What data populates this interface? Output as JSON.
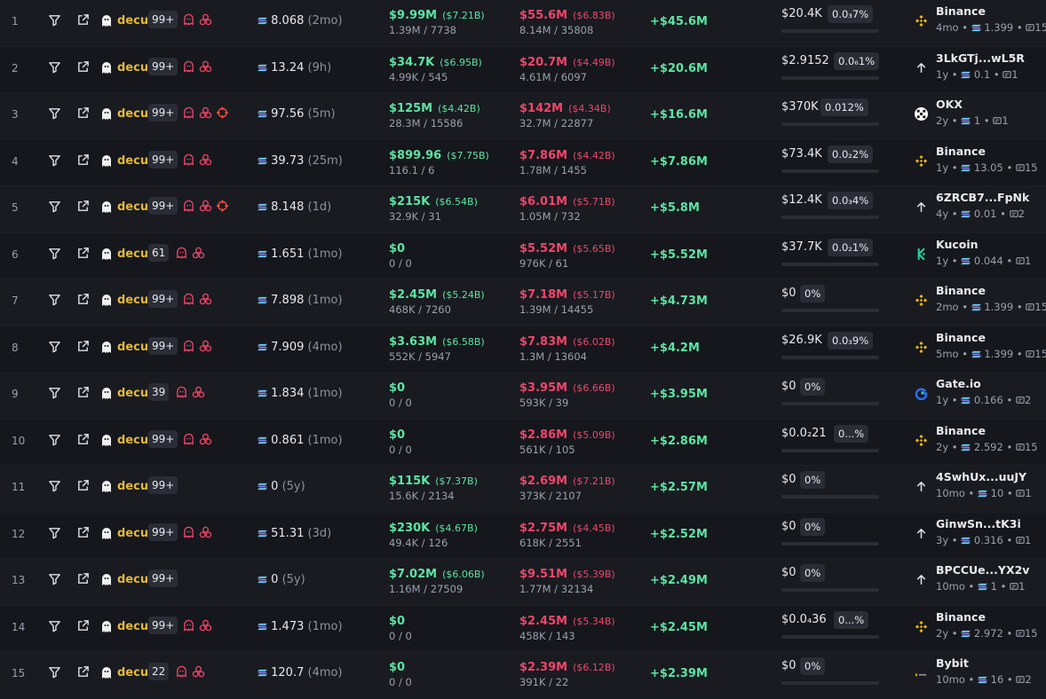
{
  "colors": {
    "background": "#15171c",
    "row_alt": "#191b21",
    "name_gold": "#e3b83b",
    "green": "#5ee3a2",
    "red": "#f0456a",
    "muted": "#9aa0ad",
    "badge_bg": "#2a2d35",
    "flag_pink": "#f0456a"
  },
  "icons": {
    "filter": "filter-icon",
    "open": "external-link-icon",
    "avatar": "ghost-icon",
    "balance": "solana-icon",
    "flags": [
      "ghost-flag-icon",
      "cluster-flag-icon",
      "crosshair-flag-icon"
    ],
    "exchange_binance": "binance-logo",
    "exchange_okx": "okx-logo",
    "exchange_kucoin": "kucoin-logo",
    "exchange_gate": "gate-logo",
    "exchange_bybit": "bybit-logo",
    "wallet_arrow": "arrow-up-icon",
    "tx": "tx-icon"
  },
  "rows": [
    {
      "rank": "1",
      "name": "decu",
      "count": "99+",
      "flags": [
        "ghost",
        "cluster"
      ],
      "balance": "8.068",
      "age": "(2mo)",
      "buy": "$9.99M",
      "buy_mc": "($7.21B)",
      "buy_sub": "1.39M / 7738",
      "sell": "$55.6M",
      "sell_mc": "($6.83B)",
      "sell_sub": "8.14M / 35808",
      "pnl": "+$45.6M",
      "hold": "$20.4K",
      "pct": "0.0₃7%",
      "source_icon": "binance",
      "source": "Binance",
      "src_age": "4mo",
      "src_bal": "1.399",
      "src_tx": "15"
    },
    {
      "rank": "2",
      "name": "decu",
      "count": "99+",
      "flags": [
        "ghost",
        "cluster"
      ],
      "balance": "13.24",
      "age": "(9h)",
      "buy": "$34.7K",
      "buy_mc": "($6.95B)",
      "buy_sub": "4.99K / 545",
      "sell": "$20.7M",
      "sell_mc": "($4.49B)",
      "sell_sub": "4.61M / 6097",
      "pnl": "+$20.6M",
      "hold": "$2.9152",
      "pct": "0.0₆1%",
      "source_icon": "arrow",
      "source": "3LkGTj...wL5R",
      "src_age": "1y",
      "src_bal": "0.1",
      "src_tx": "1"
    },
    {
      "rank": "3",
      "name": "decu",
      "count": "99+",
      "flags": [
        "ghost",
        "cluster",
        "crosshair"
      ],
      "balance": "97.56",
      "age": "(5m)",
      "buy": "$125M",
      "buy_mc": "($4.42B)",
      "buy_sub": "28.3M / 15586",
      "sell": "$142M",
      "sell_mc": "($4.34B)",
      "sell_sub": "32.7M / 22877",
      "pnl": "+$16.6M",
      "hold": "$370K",
      "pct": "0.012%",
      "source_icon": "okx",
      "source": "OKX",
      "src_age": "2y",
      "src_bal": "1",
      "src_tx": "1"
    },
    {
      "rank": "4",
      "name": "decu",
      "count": "99+",
      "flags": [
        "ghost",
        "cluster"
      ],
      "balance": "39.73",
      "age": "(25m)",
      "buy": "$899.96",
      "buy_mc": "($7.75B)",
      "buy_sub": "116.1 / 6",
      "sell": "$7.86M",
      "sell_mc": "($4.42B)",
      "sell_sub": "1.78M / 1455",
      "pnl": "+$7.86M",
      "hold": "$73.4K",
      "pct": "0.0₂2%",
      "source_icon": "binance",
      "source": "Binance",
      "src_age": "1y",
      "src_bal": "13.05",
      "src_tx": "15"
    },
    {
      "rank": "5",
      "name": "decu",
      "count": "99+",
      "flags": [
        "ghost",
        "cluster",
        "crosshair"
      ],
      "balance": "8.148",
      "age": "(1d)",
      "buy": "$215K",
      "buy_mc": "($6.54B)",
      "buy_sub": "32.9K / 31",
      "sell": "$6.01M",
      "sell_mc": "($5.71B)",
      "sell_sub": "1.05M / 732",
      "pnl": "+$5.8M",
      "hold": "$12.4K",
      "pct": "0.0₃4%",
      "source_icon": "arrow",
      "source": "6ZRCB7...FpNk",
      "src_age": "4y",
      "src_bal": "0.01",
      "src_tx": "2"
    },
    {
      "rank": "6",
      "name": "decu",
      "count": "61",
      "flags": [
        "ghost",
        "cluster"
      ],
      "balance": "1.651",
      "age": "(1mo)",
      "buy": "$0",
      "buy_mc": "",
      "buy_sub": "0 / 0",
      "sell": "$5.52M",
      "sell_mc": "($5.65B)",
      "sell_sub": "976K / 61",
      "pnl": "+$5.52M",
      "hold": "$37.7K",
      "pct": "0.0₂1%",
      "source_icon": "kucoin",
      "source": "Kucoin",
      "src_age": "1y",
      "src_bal": "0.044",
      "src_tx": "1"
    },
    {
      "rank": "7",
      "name": "decu",
      "count": "99+",
      "flags": [
        "ghost",
        "cluster"
      ],
      "balance": "7.898",
      "age": "(1mo)",
      "buy": "$2.45M",
      "buy_mc": "($5.24B)",
      "buy_sub": "468K / 7260",
      "sell": "$7.18M",
      "sell_mc": "($5.17B)",
      "sell_sub": "1.39M / 14455",
      "pnl": "+$4.73M",
      "hold": "$0",
      "pct": "0%",
      "source_icon": "binance",
      "source": "Binance",
      "src_age": "2mo",
      "src_bal": "1.399",
      "src_tx": "15"
    },
    {
      "rank": "8",
      "name": "decu",
      "count": "99+",
      "flags": [
        "ghost",
        "cluster"
      ],
      "balance": "7.909",
      "age": "(4mo)",
      "buy": "$3.63M",
      "buy_mc": "($6.58B)",
      "buy_sub": "552K / 5947",
      "sell": "$7.83M",
      "sell_mc": "($6.02B)",
      "sell_sub": "1.3M / 13604",
      "pnl": "+$4.2M",
      "hold": "$26.9K",
      "pct": "0.0₃9%",
      "source_icon": "binance",
      "source": "Binance",
      "src_age": "5mo",
      "src_bal": "1.399",
      "src_tx": "15"
    },
    {
      "rank": "9",
      "name": "decu",
      "count": "39",
      "flags": [
        "ghost",
        "cluster"
      ],
      "balance": "1.834",
      "age": "(1mo)",
      "buy": "$0",
      "buy_mc": "",
      "buy_sub": "0 / 0",
      "sell": "$3.95M",
      "sell_mc": "($6.66B)",
      "sell_sub": "593K / 39",
      "pnl": "+$3.95M",
      "hold": "$0",
      "pct": "0%",
      "source_icon": "gate",
      "source": "Gate.io",
      "src_age": "1y",
      "src_bal": "0.166",
      "src_tx": "2"
    },
    {
      "rank": "10",
      "name": "decu",
      "count": "99+",
      "flags": [
        "ghost",
        "cluster"
      ],
      "balance": "0.861",
      "age": "(1mo)",
      "buy": "$0",
      "buy_mc": "",
      "buy_sub": "0 / 0",
      "sell": "$2.86M",
      "sell_mc": "($5.09B)",
      "sell_sub": "561K / 105",
      "pnl": "+$2.86M",
      "hold": "$0.0₂21",
      "pct": "0...%",
      "source_icon": "binance",
      "source": "Binance",
      "src_age": "2y",
      "src_bal": "2.592",
      "src_tx": "15"
    },
    {
      "rank": "11",
      "name": "decu",
      "count": "99+",
      "flags": [],
      "balance": "0",
      "age": "(5y)",
      "buy": "$115K",
      "buy_mc": "($7.37B)",
      "buy_sub": "15.6K / 2134",
      "sell": "$2.69M",
      "sell_mc": "($7.21B)",
      "sell_sub": "373K / 2107",
      "pnl": "+$2.57M",
      "hold": "$0",
      "pct": "0%",
      "source_icon": "arrow",
      "source": "4SwhUx...uuJY",
      "src_age": "10mo",
      "src_bal": "10",
      "src_tx": "1"
    },
    {
      "rank": "12",
      "name": "decu",
      "count": "99+",
      "flags": [
        "ghost",
        "cluster"
      ],
      "balance": "51.31",
      "age": "(3d)",
      "buy": "$230K",
      "buy_mc": "($4.67B)",
      "buy_sub": "49.4K / 126",
      "sell": "$2.75M",
      "sell_mc": "($4.45B)",
      "sell_sub": "618K / 2551",
      "pnl": "+$2.52M",
      "hold": "$0",
      "pct": "0%",
      "source_icon": "arrow",
      "source": "GinwSn...tK3i",
      "src_age": "3y",
      "src_bal": "0.316",
      "src_tx": "1"
    },
    {
      "rank": "13",
      "name": "decu",
      "count": "99+",
      "flags": [],
      "balance": "0",
      "age": "(5y)",
      "buy": "$7.02M",
      "buy_mc": "($6.06B)",
      "buy_sub": "1.16M / 27509",
      "sell": "$9.51M",
      "sell_mc": "($5.39B)",
      "sell_sub": "1.77M / 32134",
      "pnl": "+$2.49M",
      "hold": "$0",
      "pct": "0%",
      "source_icon": "arrow",
      "source": "BPCCUe...YX2v",
      "src_age": "10mo",
      "src_bal": "1",
      "src_tx": "1"
    },
    {
      "rank": "14",
      "name": "decu",
      "count": "99+",
      "flags": [
        "ghost",
        "cluster"
      ],
      "balance": "1.473",
      "age": "(1mo)",
      "buy": "$0",
      "buy_mc": "",
      "buy_sub": "0 / 0",
      "sell": "$2.45M",
      "sell_mc": "($5.34B)",
      "sell_sub": "458K / 143",
      "pnl": "+$2.45M",
      "hold": "$0.0₄36",
      "pct": "0...%",
      "source_icon": "binance",
      "source": "Binance",
      "src_age": "2y",
      "src_bal": "2.972",
      "src_tx": "15"
    },
    {
      "rank": "15",
      "name": "decu",
      "count": "22",
      "flags": [
        "ghost",
        "cluster"
      ],
      "balance": "120.7",
      "age": "(4mo)",
      "buy": "$0",
      "buy_mc": "",
      "buy_sub": "0 / 0",
      "sell": "$2.39M",
      "sell_mc": "($6.12B)",
      "sell_sub": "391K / 22",
      "pnl": "+$2.39M",
      "hold": "$0",
      "pct": "0%",
      "source_icon": "bybit",
      "source": "Bybit",
      "src_age": "10mo",
      "src_bal": "16",
      "src_tx": "2"
    }
  ]
}
